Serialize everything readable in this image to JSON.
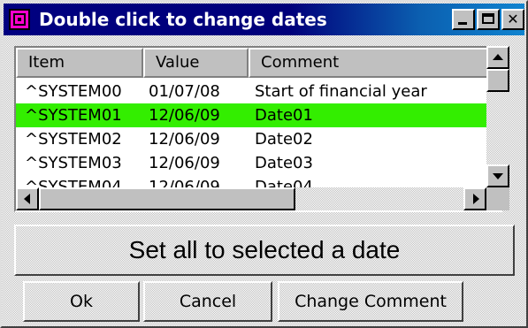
{
  "window": {
    "title": "Double click to change dates",
    "icon": "app-icon",
    "controls": [
      "minimize",
      "maximize",
      "close"
    ]
  },
  "list": {
    "columns": [
      "Item",
      "Value",
      "Comment"
    ],
    "selected_index": 1,
    "selected_color": "#33ee00",
    "rows": [
      {
        "item": "^SYSTEM00",
        "value": "01/07/08",
        "comment": "Start of financial year"
      },
      {
        "item": "^SYSTEM01",
        "value": "12/06/09",
        "comment": "Date01"
      },
      {
        "item": "^SYSTEM02",
        "value": "12/06/09",
        "comment": "Date02"
      },
      {
        "item": "^SYSTEM03",
        "value": "12/06/09",
        "comment": "Date03"
      },
      {
        "item": "^SYSTEM04",
        "value": "12/06/09",
        "comment": "Date04"
      }
    ]
  },
  "actions": {
    "set_all_label": "Set all to selected a date",
    "ok_label": "Ok",
    "cancel_label": "Cancel",
    "change_comment_label": "Change Comment"
  }
}
